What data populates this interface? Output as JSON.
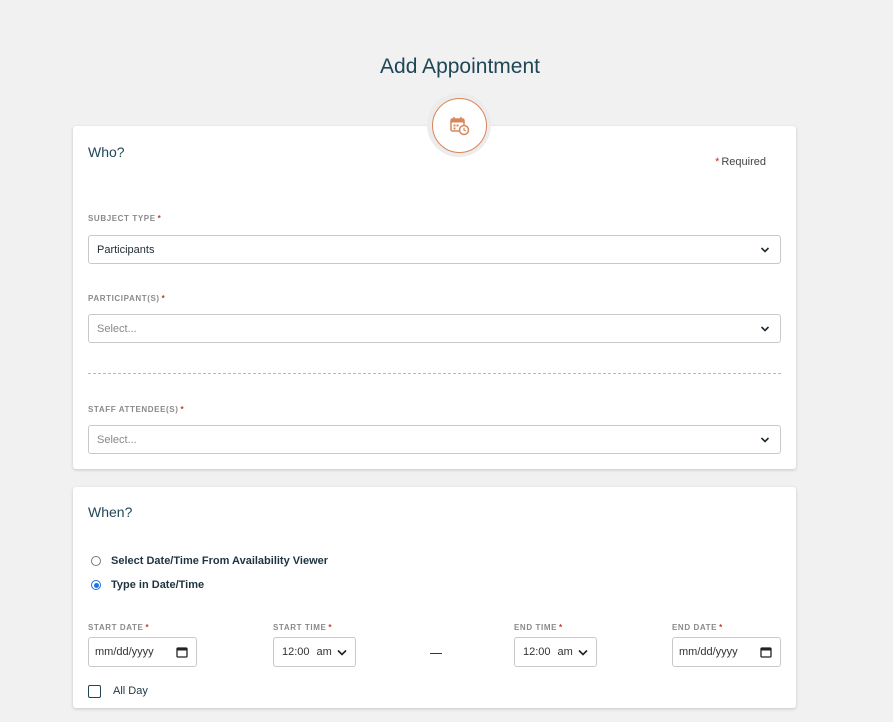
{
  "page": {
    "title": "Add Appointment"
  },
  "header_icon": "calendar-clock-icon",
  "colors": {
    "accent": "#d8875a",
    "title": "#1f4656",
    "required": "#c0392b",
    "radio": "#1a73e8"
  },
  "who": {
    "title": "Who?",
    "required_star": "*",
    "required_note": "Required",
    "subject_type": {
      "label": "SUBJECT TYPE",
      "star": "*",
      "value": "Participants"
    },
    "participants": {
      "label": "PARTICIPANT(S)",
      "star": "*",
      "placeholder": "Select..."
    },
    "staff_attendees": {
      "label": "STAFF ATTENDEE(S)",
      "star": "*",
      "placeholder": "Select..."
    }
  },
  "when": {
    "title": "When?",
    "options": [
      {
        "label": "Select Date/Time From Availability Viewer",
        "checked": false
      },
      {
        "label": "Type in Date/Time",
        "checked": true
      }
    ],
    "start_date": {
      "label": "START DATE",
      "star": "*",
      "value": "mm/dd/yyyy"
    },
    "start_time": {
      "label": "START TIME",
      "star": "*",
      "value": "12:00",
      "ampm": "am"
    },
    "end_time": {
      "label": "END TIME",
      "star": "*",
      "value": "12:00",
      "ampm": "am"
    },
    "end_date": {
      "label": "END DATE",
      "star": "*",
      "value": "mm/dd/yyyy"
    },
    "all_day": {
      "label": "All Day",
      "checked": false
    }
  }
}
